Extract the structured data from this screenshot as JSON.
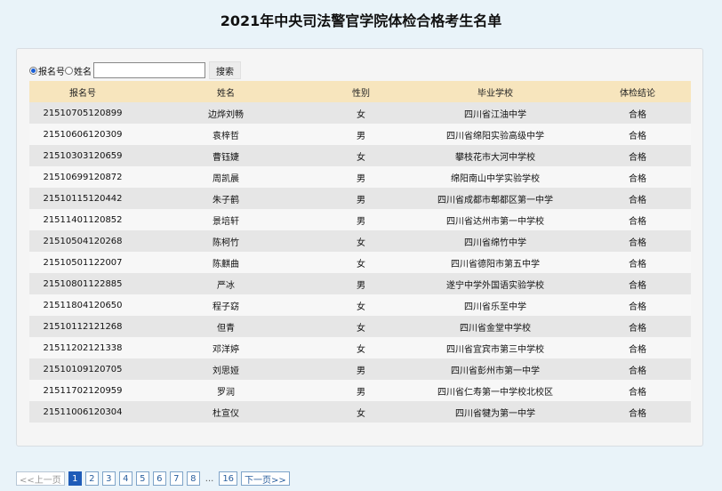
{
  "title": "2021年中央司法警官学院体检合格考生名单",
  "search": {
    "radio_options": [
      "报名号",
      "姓名"
    ],
    "selected": 0,
    "input_value": "",
    "button_label": "搜索"
  },
  "table": {
    "headers": [
      "报名号",
      "姓名",
      "性别",
      "毕业学校",
      "体检结论"
    ],
    "rows": [
      [
        "21510705120899",
        "边烨刘畅",
        "女",
        "四川省江油中学",
        "合格"
      ],
      [
        "21510606120309",
        "袁梓哲",
        "男",
        "四川省绵阳实验高级中学",
        "合格"
      ],
      [
        "21510303120659",
        "曹钰婕",
        "女",
        "攀枝花市大河中学校",
        "合格"
      ],
      [
        "21510699120872",
        "周凯晨",
        "男",
        "绵阳南山中学实验学校",
        "合格"
      ],
      [
        "21510115120442",
        "朱子鹤",
        "男",
        "四川省成都市郫都区第一中学",
        "合格"
      ],
      [
        "21511401120852",
        "景培轩",
        "男",
        "四川省达州市第一中学校",
        "合格"
      ],
      [
        "21510504120268",
        "陈柯竹",
        "女",
        "四川省绵竹中学",
        "合格"
      ],
      [
        "21510501122007",
        "陈麒曲",
        "女",
        "四川省德阳市第五中学",
        "合格"
      ],
      [
        "21510801122885",
        "严冰",
        "男",
        "遂宁中学外国语实验学校",
        "合格"
      ],
      [
        "21511804120650",
        "程子窈",
        "女",
        "四川省乐至中学",
        "合格"
      ],
      [
        "21510112121268",
        "但青",
        "女",
        "四川省金堂中学校",
        "合格"
      ],
      [
        "21511202121338",
        "邓洋婷",
        "女",
        "四川省宜宾市第三中学校",
        "合格"
      ],
      [
        "21510109120705",
        "刘思娅",
        "男",
        "四川省彭州市第一中学",
        "合格"
      ],
      [
        "21511702120959",
        "罗润",
        "男",
        "四川省仁寿第一中学校北校区",
        "合格"
      ],
      [
        "21511006120304",
        "杜宣仪",
        "女",
        "四川省犍为第一中学",
        "合格"
      ]
    ]
  },
  "pagination": {
    "prev_label": "<<上一页",
    "pages": [
      "1",
      "2",
      "3",
      "4",
      "5",
      "6",
      "7",
      "8"
    ],
    "current": "1",
    "ellipsis": "...",
    "last_page": "16",
    "next_label": "下一页>>"
  }
}
